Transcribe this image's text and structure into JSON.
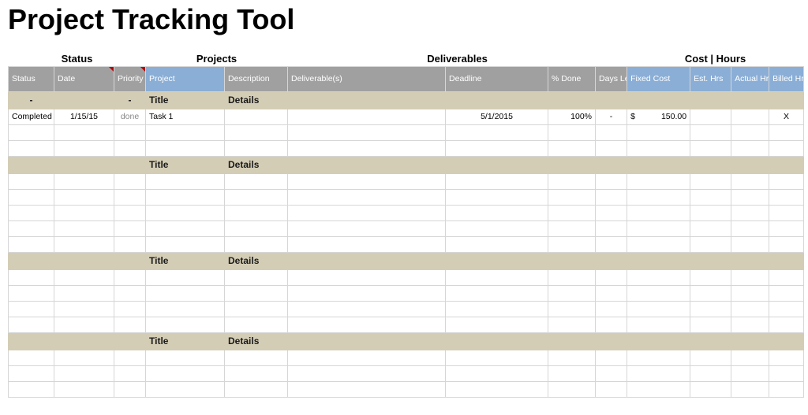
{
  "title": "Project Tracking Tool",
  "groups": {
    "status": "Status",
    "projects": "Projects",
    "deliverables": "Deliverables",
    "cost_hours": "Cost | Hours"
  },
  "headers": {
    "status": "Status",
    "date": "Date",
    "priority": "Priority",
    "project": "Project",
    "description": "Description",
    "deliverables": "Deliverable(s)",
    "deadline": "Deadline",
    "pct_done": "% Done",
    "days_left": "Days Left",
    "fixed_cost": "Fixed Cost",
    "est_hrs": "Est. Hrs",
    "actual_hrs": "Actual Hrs",
    "billed_hrs": "Billed Hrs"
  },
  "section": {
    "dash": "-",
    "title": "Title",
    "details": "Details"
  },
  "row1": {
    "status": "Completed",
    "date": "1/15/15",
    "priority": "done",
    "project": "Task 1",
    "description": "",
    "deliverables": "",
    "deadline": "5/1/2015",
    "pct_done": "100%",
    "days_left": "-",
    "fixed_cost_sym": "$",
    "fixed_cost_val": "150.00",
    "est_hrs": "",
    "actual_hrs": "",
    "billed_hrs": "X"
  }
}
